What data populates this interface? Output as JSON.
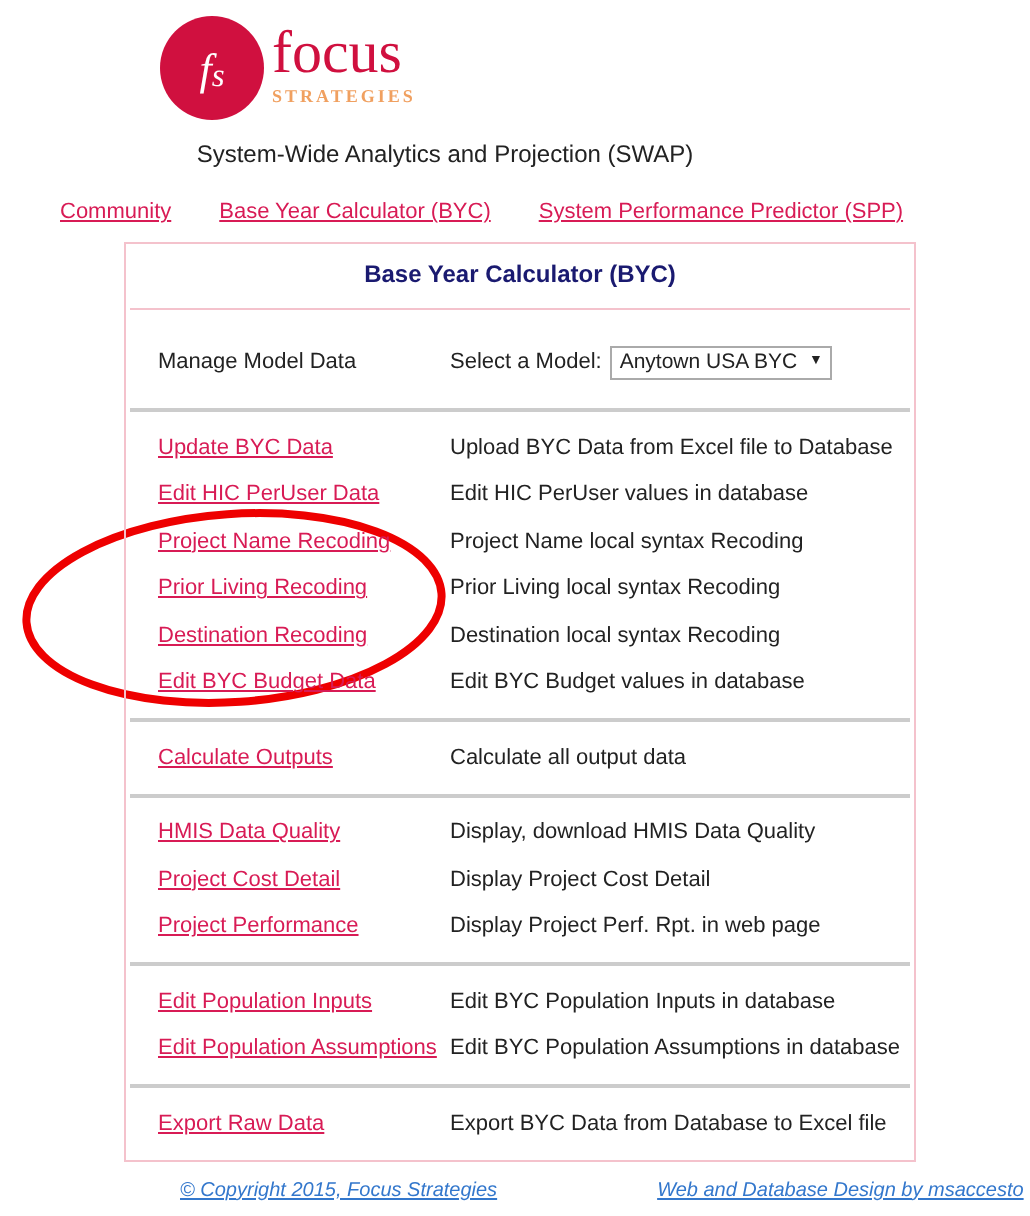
{
  "logo": {
    "monogram": "f$_{s}$",
    "name": "focus",
    "tagline": "STRATEGIES"
  },
  "subtitle": "System-Wide Analytics and Projection (SWAP)",
  "nav": [
    {
      "label": "Community"
    },
    {
      "label": "Base Year Calculator (BYC)"
    },
    {
      "label": "System Performance Predictor (SPP)"
    }
  ],
  "panel": {
    "title": "Base Year Calculator (BYC)",
    "manage": {
      "label": "Manage Model Data",
      "select_label": "Select a Model:",
      "select_value": "Anytown USA BYC",
      "select_arrow": "▼"
    },
    "groups": [
      [
        {
          "link": "Update BYC Data",
          "description": "Upload BYC Data from Excel file to Database"
        },
        {
          "link": "Edit HIC PerUser Data",
          "description": "Edit HIC PerUser values in database"
        },
        {
          "link": "Project Name Recoding",
          "description": "Project Name local syntax Recoding"
        },
        {
          "link": "Prior Living Recoding",
          "description": "Prior Living local syntax Recoding"
        },
        {
          "link": "Destination Recoding",
          "description": "Destination local syntax Recoding"
        },
        {
          "link": "Edit BYC Budget Data",
          "description": "Edit BYC Budget values in database"
        }
      ],
      [
        {
          "link": "Calculate Outputs",
          "description": "Calculate all output data"
        }
      ],
      [
        {
          "link": "HMIS Data Quality",
          "description": "Display, download HMIS Data Quality"
        },
        {
          "link": "Project Cost Detail",
          "description": "Display Project Cost Detail"
        },
        {
          "link": "Project Performance",
          "description": "Display Project Perf. Rpt. in web page"
        }
      ],
      [
        {
          "link": "Edit Population Inputs",
          "description": "Edit BYC Population Inputs in database"
        },
        {
          "link": "Edit Population Assumptions",
          "description": "Edit BYC Population Assumptions in database"
        }
      ],
      [
        {
          "link": "Export Raw Data",
          "description": "Export BYC Data from Database to Excel file"
        }
      ]
    ]
  },
  "footer": {
    "copyright": "© Copyright 2015, Focus Strategies",
    "credit": "Web and Database Design by msaccesto"
  }
}
